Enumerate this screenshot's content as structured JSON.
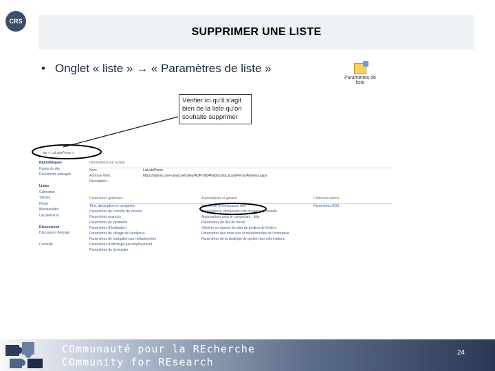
{
  "logo_text": "CRS",
  "title": "SUPPRIMER UNE LISTE",
  "bullet": {
    "dot": "•",
    "text": "Onglet « liste » → « Paramètres de liste »"
  },
  "param_icon": {
    "label": "Paramètres de liste",
    "icon": "settings-list-icon"
  },
  "callout": "Vérifier ici qu’il s’agit bien de la liste qu’on souhaite supprimer",
  "screenshot": {
    "breadcrumb": "ste > LaListePerso >",
    "sidebar": [
      {
        "label": "Bibliothèques",
        "header": true
      },
      {
        "label": "Pages du site",
        "header": false
      },
      {
        "label": "Documents partagés",
        "header": false
      },
      {
        "label": "",
        "header": false
      },
      {
        "label": "Listes",
        "header": true
      },
      {
        "label": "Calendrier",
        "header": false
      },
      {
        "label": "Tâches",
        "header": false
      },
      {
        "label": "Photo",
        "header": false
      },
      {
        "label": "Mavieaulabo",
        "header": false
      },
      {
        "label": "LaListePerso",
        "header": false
      },
      {
        "label": "",
        "header": false
      },
      {
        "label": "Discussions",
        "header": true
      },
      {
        "label": "Discussion d'équipe",
        "header": false
      },
      {
        "label": "",
        "header": false
      },
      {
        "label": "Corbeille",
        "header": false
      }
    ],
    "info_title": "Informations sur la liste",
    "info_rows": [
      {
        "k": "Nom :",
        "v": "LaListePerso"
      },
      {
        "k": "Adresse Web :",
        "v": "https://admin.core-cloud.net/sites/ADPrd684Nab/Lists/LaListePerso/AllItems.aspx"
      },
      {
        "k": "Description :",
        "v": ""
      }
    ],
    "col1": {
      "head": "Paramètres généraux",
      "items": [
        "Titre, description et navigation",
        "Paramètres de contrôle de version",
        "Paramètres avancés",
        "Paramètres de validation",
        "Paramètres d'évaluation",
        "Paramètres de ciblage de l'audience",
        "Paramètres de navigation par métadonnées",
        "Paramètres d'affichage par emplacement",
        "Paramètres du formulaire"
      ]
    },
    "col2": {
      "head": "Autorisations et gestion",
      "items": [
        "Supprimer le composant liste",
        "Enregistrer le composant liste en tant que modèle",
        "Autorisations pour le composant : liste",
        "Paramètres de flux de travail",
        "Générer un rapport de plan de gestion de fichiers",
        "Paramètres des mots clés et métadonnées de l'entreprise",
        "Paramètres de la stratégie de gestion des informations"
      ]
    },
    "col3": {
      "head": "Communications",
      "items": [
        "Paramètres RSS"
      ]
    }
  },
  "footer": {
    "line1": "COmmunauté pour la REcherche",
    "line2": "COmmunity for REsearch",
    "page": "24"
  }
}
